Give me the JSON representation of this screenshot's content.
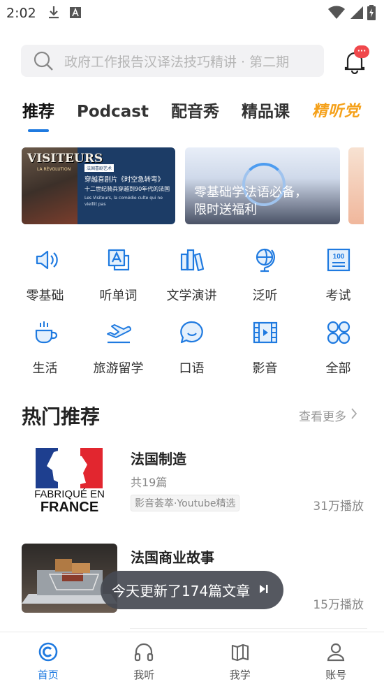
{
  "status_bar": {
    "time": "2:02",
    "icons": [
      "download-icon",
      "a-badge-icon",
      "wifi-icon",
      "signal-icon",
      "battery-icon"
    ]
  },
  "search": {
    "placeholder": "政府工作报告汉译法技巧精讲 · 第二期"
  },
  "notifications": {
    "badge": "···"
  },
  "tabs": [
    {
      "label": "推荐",
      "active": true
    },
    {
      "label": "Podcast",
      "active": false
    },
    {
      "label": "配音秀",
      "active": false
    },
    {
      "label": "精品课",
      "active": false
    },
    {
      "label": "精听党",
      "active": false
    }
  ],
  "banners": {
    "banner1": {
      "photo_title": "VISITEURS",
      "photo_sub": "LA RÉVOLUTION",
      "tag": "法国喜剧艺术",
      "line1": "穿越喜剧片《时空急转弯》",
      "line2": "十二世纪骑兵穿越到90年代的法国",
      "line3": "Les Visiteurs, la comédie culte qui ne vieillit pas"
    },
    "banner2": {
      "line1": "零基础学法语必备，",
      "line2": "限时送福利"
    }
  },
  "categories": [
    {
      "label": "零基础",
      "icon": "speaker-icon"
    },
    {
      "label": "听单词",
      "icon": "translate-icon"
    },
    {
      "label": "文学演讲",
      "icon": "books-icon"
    },
    {
      "label": "泛听",
      "icon": "globe-icon"
    },
    {
      "label": "考试",
      "icon": "exam-100-icon"
    },
    {
      "label": "生活",
      "icon": "coffee-cup-icon"
    },
    {
      "label": "旅游留学",
      "icon": "airplane-icon"
    },
    {
      "label": "口语",
      "icon": "chat-bubble-icon"
    },
    {
      "label": "影音",
      "icon": "film-icon"
    },
    {
      "label": "全部",
      "icon": "grid-all-icon"
    }
  ],
  "hot": {
    "title": "热门推荐",
    "see_more": "查看更多",
    "items": [
      {
        "title": "法国制造",
        "count": "共19篇",
        "tag": "影音荟萃·Youtube精选",
        "plays": "31万播放",
        "thumb_line1": "FABRIQUÉ EN",
        "thumb_line2": "FRANCE"
      },
      {
        "title": "法国商业故事",
        "count": "",
        "tag": "",
        "plays": "15万播放"
      }
    ]
  },
  "toast": {
    "text": "今天更新了174篇文章"
  },
  "bottom_nav": [
    {
      "label": "首页",
      "icon": "home-icon",
      "active": true
    },
    {
      "label": "我听",
      "icon": "headphones-icon",
      "active": false
    },
    {
      "label": "我学",
      "icon": "book-icon",
      "active": false
    },
    {
      "label": "账号",
      "icon": "user-icon",
      "active": false
    }
  ],
  "colors": {
    "accent": "#1f7ae0",
    "badge": "#f0484c",
    "jingting": "#f5a11a"
  }
}
